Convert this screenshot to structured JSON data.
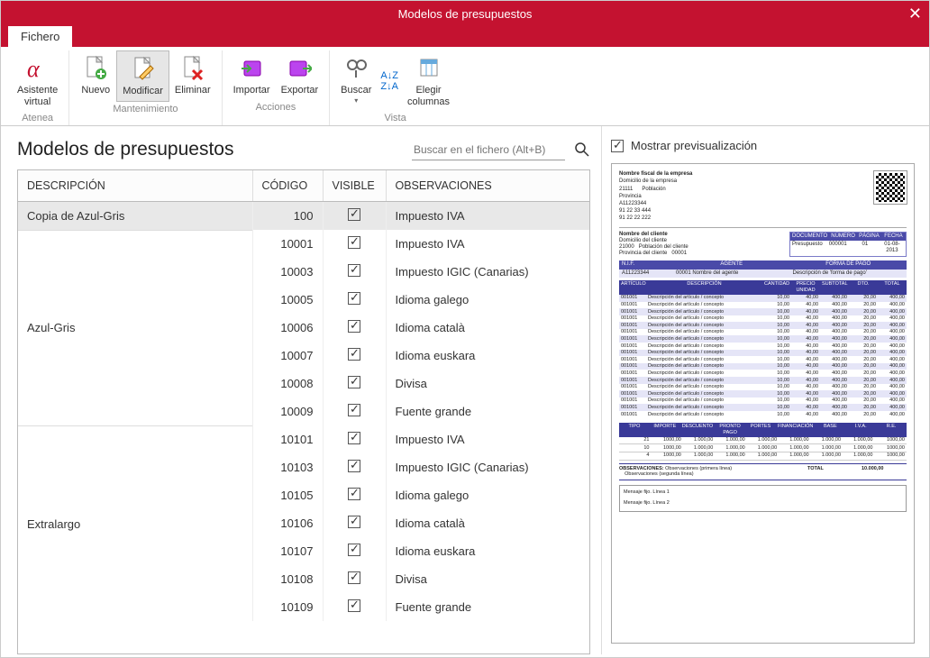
{
  "window": {
    "title": "Modelos de presupuestos",
    "close": "✕"
  },
  "tabs": {
    "fichero": "Fichero"
  },
  "ribbon": {
    "atenea": {
      "label": "Asistente\nvirtual",
      "group": "Atenea"
    },
    "mantenimiento": {
      "nuevo": "Nuevo",
      "modificar": "Modificar",
      "eliminar": "Eliminar",
      "group": "Mantenimiento"
    },
    "acciones": {
      "importar": "Importar",
      "exportar": "Exportar",
      "group": "Acciones"
    },
    "vista": {
      "buscar": "Buscar",
      "elegir": "Elegir\ncolumnas",
      "group": "Vista"
    }
  },
  "left": {
    "heading": "Modelos de presupuestos",
    "search_placeholder": "Buscar en el fichero (Alt+B)",
    "columns": {
      "descripcion": "DESCRIPCIÓN",
      "codigo": "CÓDIGO",
      "visible": "VISIBLE",
      "observaciones": "OBSERVACIONES"
    },
    "groups": [
      {
        "desc": "Copia de Azul-Gris",
        "selected": true,
        "rows": [
          {
            "codigo": "100",
            "visible": true,
            "obs": "Impuesto IVA"
          }
        ]
      },
      {
        "desc": "Azul-Gris",
        "rows": [
          {
            "codigo": "10001",
            "visible": true,
            "obs": "Impuesto IVA"
          },
          {
            "codigo": "10003",
            "visible": true,
            "obs": "Impuesto IGIC (Canarias)"
          },
          {
            "codigo": "10005",
            "visible": true,
            "obs": "Idioma galego"
          },
          {
            "codigo": "10006",
            "visible": true,
            "obs": "Idioma català"
          },
          {
            "codigo": "10007",
            "visible": true,
            "obs": "Idioma euskara"
          },
          {
            "codigo": "10008",
            "visible": true,
            "obs": "Divisa"
          },
          {
            "codigo": "10009",
            "visible": true,
            "obs": "Fuente grande"
          }
        ]
      },
      {
        "desc": "Extralargo",
        "rows": [
          {
            "codigo": "10101",
            "visible": true,
            "obs": "Impuesto IVA"
          },
          {
            "codigo": "10103",
            "visible": true,
            "obs": "Impuesto IGIC (Canarias)"
          },
          {
            "codigo": "10105",
            "visible": true,
            "obs": "Idioma galego"
          },
          {
            "codigo": "10106",
            "visible": true,
            "obs": "Idioma català"
          },
          {
            "codigo": "10107",
            "visible": true,
            "obs": "Idioma euskara"
          },
          {
            "codigo": "10108",
            "visible": true,
            "obs": "Divisa"
          },
          {
            "codigo": "10109",
            "visible": true,
            "obs": "Fuente grande"
          }
        ]
      }
    ]
  },
  "right": {
    "show_preview": "Mostrar previsualización",
    "doc": {
      "company": {
        "name": "Nombre fiscal de la empresa",
        "addr": "Domicilio de la empresa",
        "cp": "21111",
        "poblacion": "Población",
        "provincia": "Provincia",
        "cif": "A11223344",
        "tel": "91 22 33 444",
        "fax": "91 22 22 222"
      },
      "client": {
        "name": "Nombre del cliente",
        "addr": "Domicilio del cliente",
        "cp": "21000",
        "poblacion": "Población del cliente",
        "provincia": "Provincia del cliente",
        "code": "00001"
      },
      "meta": {
        "h1": "DOCUMENTO",
        "h2": "NÚMERO",
        "h3": "PÁGINA",
        "h4": "FECHA",
        "v1": "Presupuesto",
        "v2": "000001",
        "v3": "01",
        "v4": "01-08-2013"
      },
      "bar": {
        "nif": "N.I.F.",
        "agente": "AGENTE",
        "forma": "FORMA DE PAGO",
        "nif_v": "A11223344",
        "agente_v": "00001   Nombre del agente",
        "forma_v": "Descripción de 'forma de pago'"
      },
      "items_hdr": [
        "ARTÍCULO",
        "DESCRIPCIÓN",
        "CANTIDAD",
        "PRECIO UNIDAD",
        "SUBTOTAL",
        "DTO.",
        "TOTAL"
      ],
      "item": {
        "art": "001001",
        "desc": "Descripción del artículo / concepto",
        "cant": "10,00",
        "precio": "40,00",
        "sub": "400,00",
        "dto": "20,00",
        "tot": "400,00"
      },
      "item_count": 18,
      "totals_hdr": [
        "TIPO",
        "IMPORTE",
        "DESCUENTO",
        "PRONTO PAGO",
        "PORTES",
        "FINANCIACIÓN",
        "BASE",
        "I.V.A.",
        "R.E."
      ],
      "totals_rows": [
        [
          "21",
          "1000,00",
          "1.000,00",
          "1.000,00",
          "1.000,00",
          "1.000,00",
          "1.000,00",
          "1.000,00",
          "1000,00"
        ],
        [
          "10",
          "1000,00",
          "1.000,00",
          "1.000,00",
          "1.000,00",
          "1.000,00",
          "1.000,00",
          "1.000,00",
          "1000,00"
        ],
        [
          "4",
          "1000,00",
          "1.000,00",
          "1.000,00",
          "1.000,00",
          "1.000,00",
          "1.000,00",
          "1.000,00",
          "1000,00"
        ]
      ],
      "obs_label": "OBSERVACIONES:",
      "obs1": "Observaciones (primera línea)",
      "obs2": "Observaciones (segunda línea)",
      "total_label": "TOTAL",
      "total_value": "10.000,00",
      "msg1": "Mensaje fijo. Línea 1",
      "msg2": "Mensaje fijo. Línea 2"
    }
  }
}
